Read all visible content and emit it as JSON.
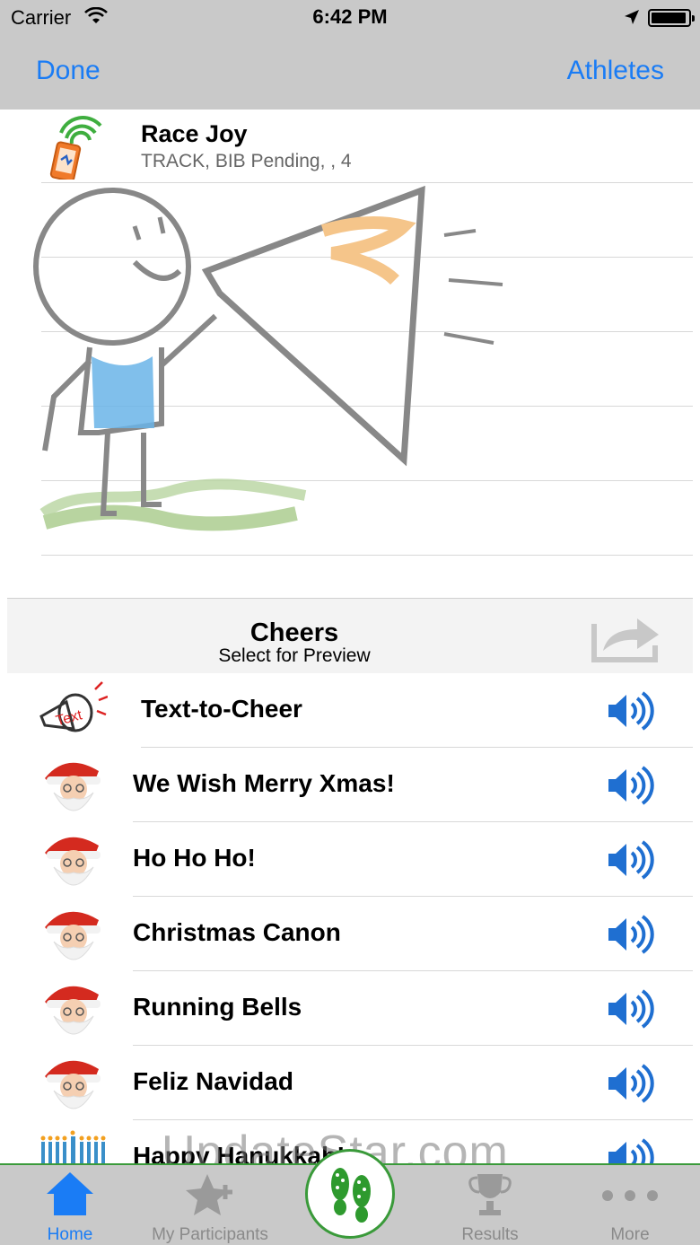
{
  "status_bar": {
    "carrier": "Carrier",
    "time": "6:42 PM"
  },
  "nav": {
    "left_button": "Done",
    "right_button": "Athletes"
  },
  "athlete": {
    "name": "Race Joy",
    "detail": "TRACK, BIB Pending, , 4"
  },
  "cheers": {
    "title": "Cheers",
    "subtitle": "Select for Preview",
    "items": [
      {
        "label": "Text-to-Cheer",
        "icon": "megaphone-text-icon"
      },
      {
        "label": "We Wish Merry Xmas!",
        "icon": "santa-icon"
      },
      {
        "label": "Ho Ho Ho!",
        "icon": "santa-icon"
      },
      {
        "label": "Christmas Canon",
        "icon": "santa-icon"
      },
      {
        "label": "Running Bells",
        "icon": "santa-icon"
      },
      {
        "label": "Feliz Navidad",
        "icon": "santa-icon"
      },
      {
        "label": "Happy Hanukkah!",
        "icon": "menorah-icon"
      }
    ]
  },
  "watermark": "UpdateStar.com",
  "tabs": [
    {
      "label": "Home",
      "icon": "home-icon",
      "active": true
    },
    {
      "label": "My Participants",
      "icon": "star-plus-icon",
      "active": false
    },
    {
      "label": "",
      "icon": "footprints-icon",
      "active": false
    },
    {
      "label": "Results",
      "icon": "trophy-icon",
      "active": false
    },
    {
      "label": "More",
      "icon": "more-dots-icon",
      "active": false
    }
  ],
  "colors": {
    "accent": "#1a7cf5",
    "bar": "#c9c9c9",
    "green": "#3a9a3a",
    "speaker": "#1f6fd1"
  }
}
